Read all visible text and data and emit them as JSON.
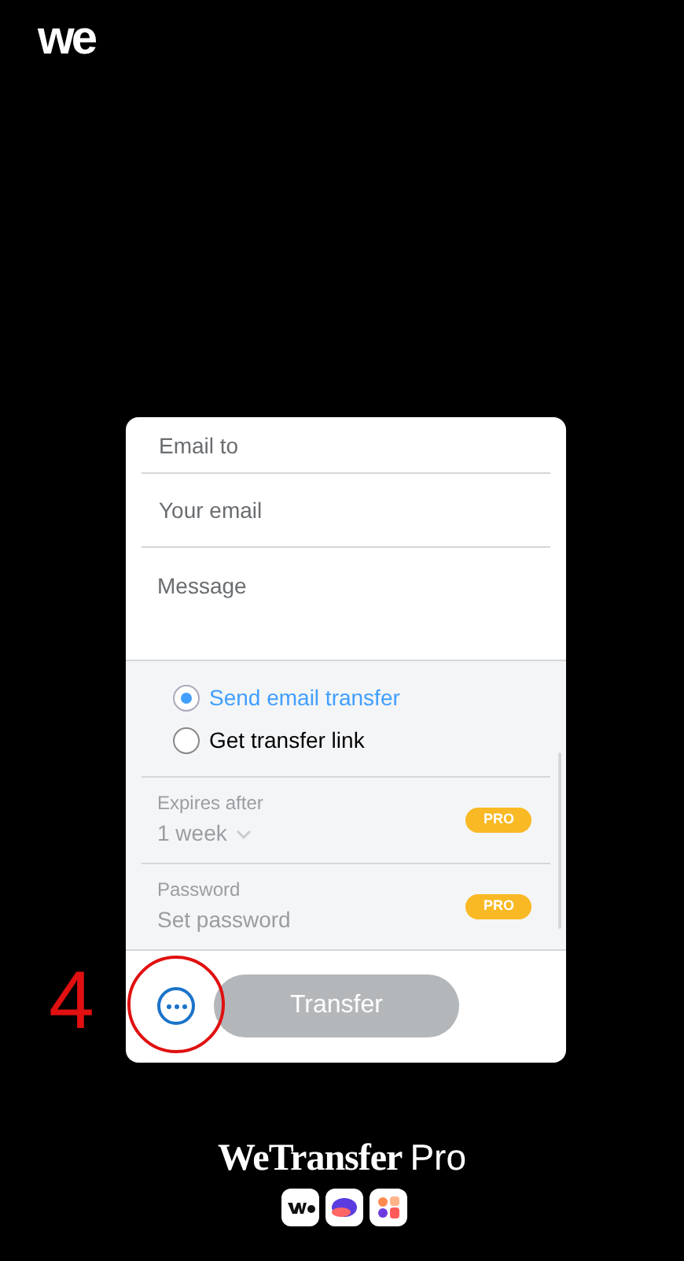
{
  "logo": "we",
  "form": {
    "fields": [
      {
        "placeholder": "Email to"
      },
      {
        "placeholder": "Your email"
      },
      {
        "placeholder": "Message",
        "kind": "textarea"
      }
    ],
    "options": [
      {
        "label": "Send email transfer",
        "selected": true
      },
      {
        "label": "Get transfer link",
        "selected": false
      }
    ],
    "settings": [
      {
        "label": "Expires after",
        "value": "1 week",
        "kind": "select",
        "badge": "PRO"
      },
      {
        "label": "Password",
        "value": "Set password",
        "kind": "text",
        "badge": "PRO"
      }
    ],
    "transfer_button": {
      "label": "Transfer",
      "disabled": true
    }
  },
  "annotation": {
    "number": "4"
  },
  "footer": {
    "brand": "WeTransfer",
    "suffix": "Pro"
  }
}
